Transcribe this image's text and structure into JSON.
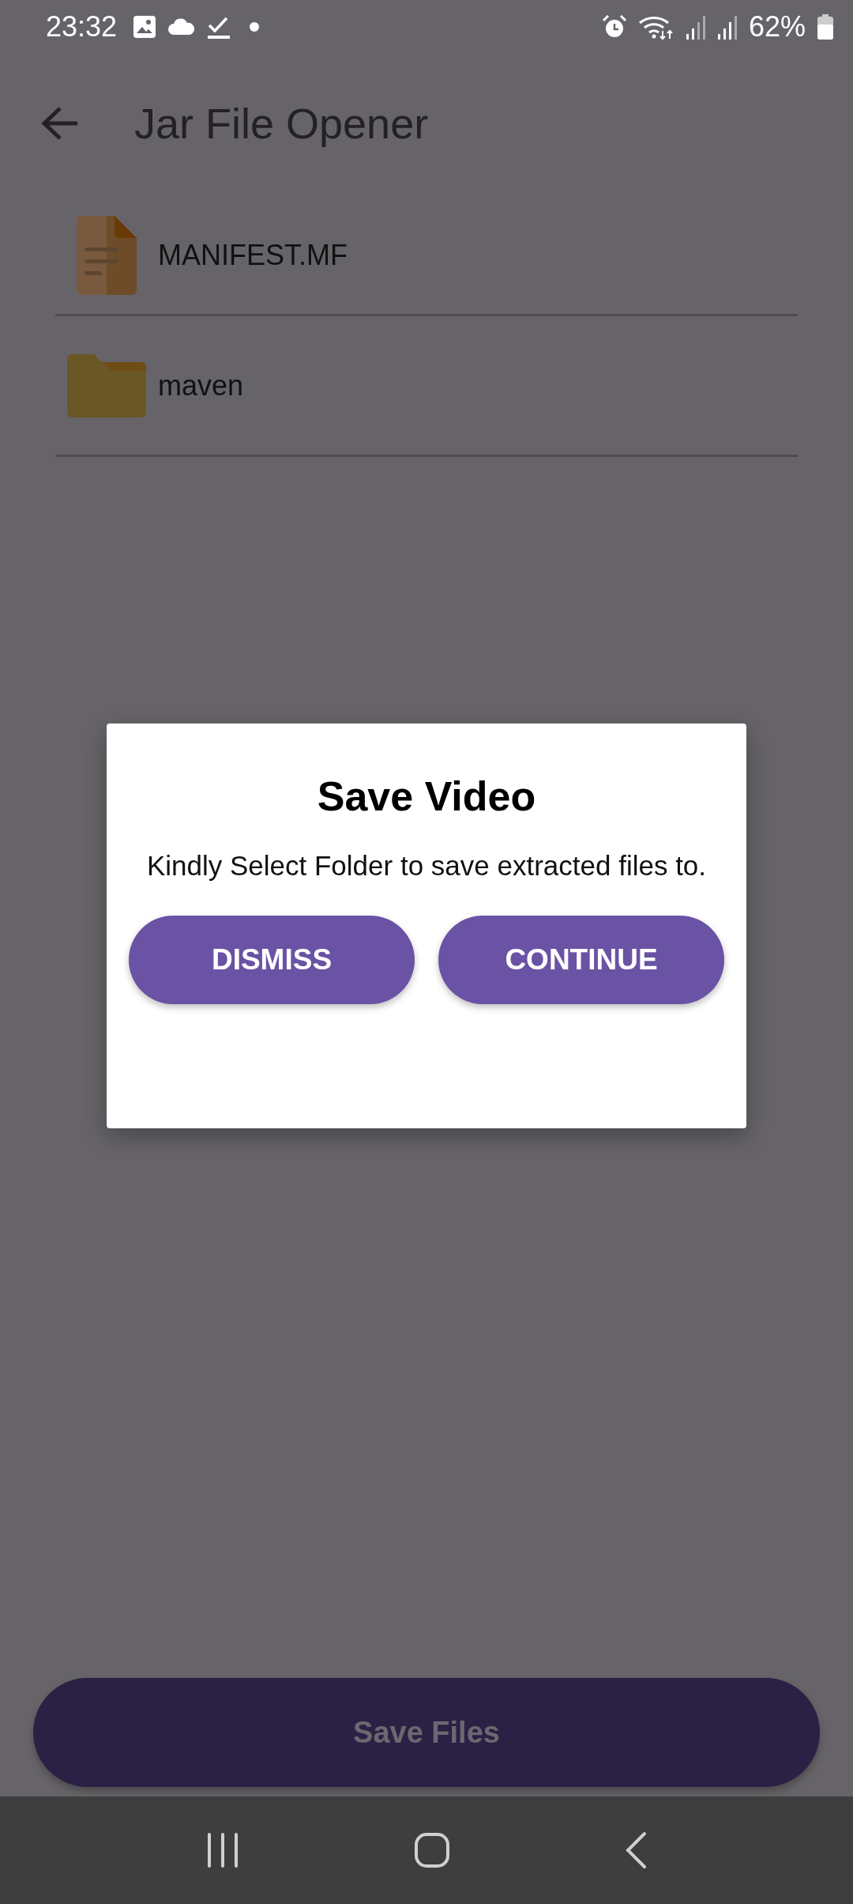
{
  "status_bar": {
    "time": "23:32",
    "battery": "62%"
  },
  "app_bar": {
    "title": "Jar File Opener"
  },
  "files": [
    {
      "name": "MANIFEST.MF",
      "kind": "file"
    },
    {
      "name": "maven",
      "kind": "folder"
    }
  ],
  "dialog": {
    "title": "Save Video",
    "message": "Kindly Select Folder to save extracted files to.",
    "buttons": [
      "DISMISS",
      "CONTINUE"
    ]
  },
  "save_button": {
    "label": "Save Files"
  }
}
